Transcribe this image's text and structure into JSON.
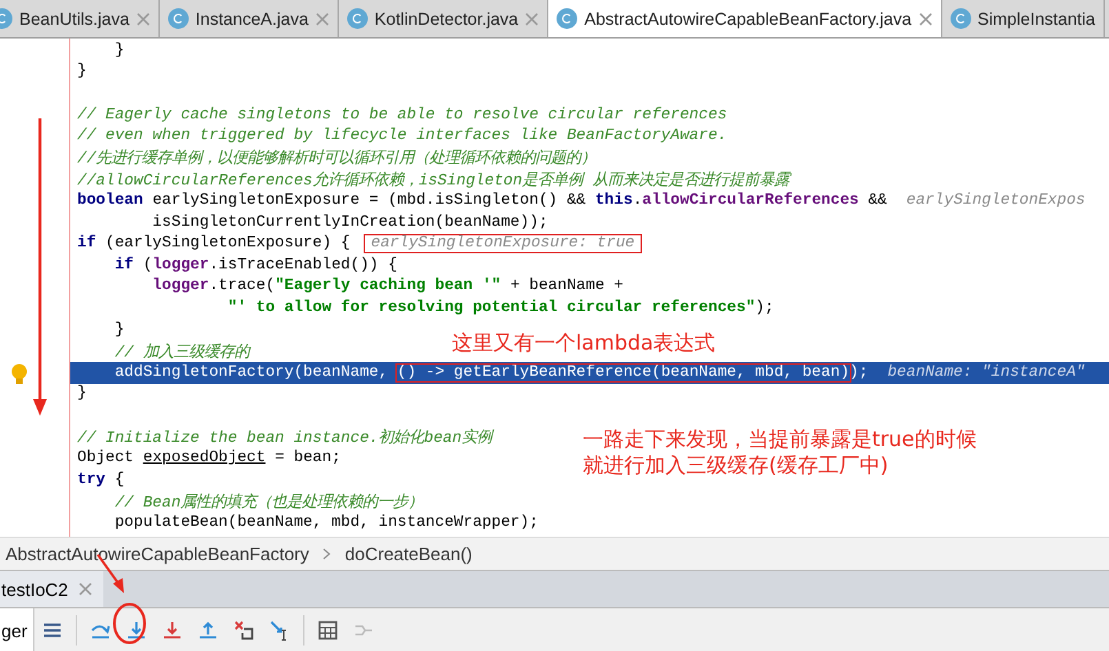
{
  "tabs": [
    {
      "label": "BeanUtils.java",
      "selected": false
    },
    {
      "label": "InstanceA.java",
      "selected": false
    },
    {
      "label": "KotlinDetector.java",
      "selected": false
    },
    {
      "label": "AbstractAutowireCapableBeanFactory.java",
      "selected": true
    },
    {
      "label": "SimpleInstantia",
      "selected": false
    }
  ],
  "code_lines": [
    {
      "kind": "code",
      "segments": [
        {
          "kind": "plain",
          "text": "    }"
        }
      ]
    },
    {
      "kind": "code",
      "segments": [
        {
          "kind": "plain",
          "text": "}"
        }
      ]
    },
    {
      "kind": "blank"
    },
    {
      "kind": "code",
      "segments": [
        {
          "kind": "comment",
          "text": "// Eagerly cache singletons to be able to resolve circular references"
        }
      ]
    },
    {
      "kind": "code",
      "segments": [
        {
          "kind": "comment",
          "text": "// even when triggered by lifecycle interfaces like BeanFactoryAware."
        }
      ]
    },
    {
      "kind": "code",
      "segments": [
        {
          "kind": "comment",
          "text": "//先进行缓存单例，以便能够解析时可以循环引用（处理循环依赖的问题的）"
        }
      ]
    },
    {
      "kind": "code",
      "segments": [
        {
          "kind": "comment",
          "text": "//allowCircularReferences允许循环依赖，isSingleton是否单例 从而来决定是否进行提前暴露"
        }
      ]
    },
    {
      "kind": "code",
      "segments": [
        {
          "kind": "keyword",
          "text": "boolean"
        },
        {
          "kind": "plain",
          "text": " earlySingletonExposure = (mbd.isSingleton() && "
        },
        {
          "kind": "keyword",
          "text": "this"
        },
        {
          "kind": "plain",
          "text": "."
        },
        {
          "kind": "field",
          "text": "allowCircularReferences"
        },
        {
          "kind": "plain",
          "text": " &&"
        }
      ],
      "hint": {
        "text": "earlySingletonExpos",
        "boxed": false
      }
    },
    {
      "kind": "code",
      "segments": [
        {
          "kind": "plain",
          "text": "        isSingletonCurrentlyInCreation(beanName));"
        }
      ]
    },
    {
      "kind": "code",
      "segments": [
        {
          "kind": "keyword",
          "text": "if"
        },
        {
          "kind": "plain",
          "text": " (earlySingletonExposure) {"
        }
      ],
      "hint": {
        "text": "earlySingletonExposure: true",
        "boxed": true
      }
    },
    {
      "kind": "code",
      "segments": [
        {
          "kind": "keyword",
          "text": "    if"
        },
        {
          "kind": "plain",
          "text": " ("
        },
        {
          "kind": "field",
          "text": "logger"
        },
        {
          "kind": "plain",
          "text": ".isTraceEnabled()) {"
        }
      ]
    },
    {
      "kind": "code",
      "segments": [
        {
          "kind": "field",
          "text": "        logger"
        },
        {
          "kind": "plain",
          "text": ".trace("
        },
        {
          "kind": "string",
          "text": "\"Eagerly caching bean '\""
        },
        {
          "kind": "plain",
          "text": " + beanName +"
        }
      ]
    },
    {
      "kind": "code",
      "segments": [
        {
          "kind": "string",
          "text": "                \"' to allow for resolving potential circular references\""
        },
        {
          "kind": "plain",
          "text": ");"
        }
      ]
    },
    {
      "kind": "code",
      "segments": [
        {
          "kind": "plain",
          "text": "    }"
        }
      ]
    },
    {
      "kind": "code",
      "segments": [
        {
          "kind": "comment",
          "text": "    // 加入三级缓存的"
        }
      ]
    },
    {
      "kind": "code",
      "highlighted": true,
      "segments": [
        {
          "kind": "plain",
          "text": "    addSingletonFactory(beanName, "
        },
        {
          "kind": "boxed",
          "text": "() -> getEarlyBeanReference(beanName, mbd, bean)"
        },
        {
          "kind": "plain",
          "text": ");"
        }
      ],
      "hint": {
        "text": "beanName: \"instanceA\"",
        "boxed": false
      }
    },
    {
      "kind": "code",
      "segments": [
        {
          "kind": "plain",
          "text": "}"
        }
      ]
    },
    {
      "kind": "blank"
    },
    {
      "kind": "code",
      "segments": [
        {
          "kind": "comment",
          "text": "// Initialize the bean instance.初始化bean实例"
        }
      ]
    },
    {
      "kind": "code",
      "segments": [
        {
          "kind": "plain",
          "text": "Object "
        },
        {
          "kind": "underline",
          "text": "exposedObject"
        },
        {
          "kind": "plain",
          "text": " = bean;"
        }
      ]
    },
    {
      "kind": "code",
      "segments": [
        {
          "kind": "keyword",
          "text": "try"
        },
        {
          "kind": "plain",
          "text": " {"
        }
      ]
    },
    {
      "kind": "code",
      "segments": [
        {
          "kind": "comment",
          "text": "    // Bean属性的填充（也是处理依赖的一步）"
        }
      ]
    },
    {
      "kind": "code",
      "segments": [
        {
          "kind": "plain",
          "text": "    populateBean(beanName, mbd, instanceWrapper);"
        }
      ]
    }
  ],
  "notes": [
    {
      "lines": [
        "这里又有一个lambda表达式"
      ]
    },
    {
      "lines": [
        "一路走下来发现，当提前暴露是true的时候",
        "就进行加入三级缓存(缓存工厂中)"
      ]
    }
  ],
  "breadcrumb": [
    "AbstractAutowireCapableBeanFactory",
    "doCreateBean()"
  ],
  "debug_tab": {
    "label": "testIoC2"
  },
  "debugger_tab": {
    "label": "ger"
  }
}
